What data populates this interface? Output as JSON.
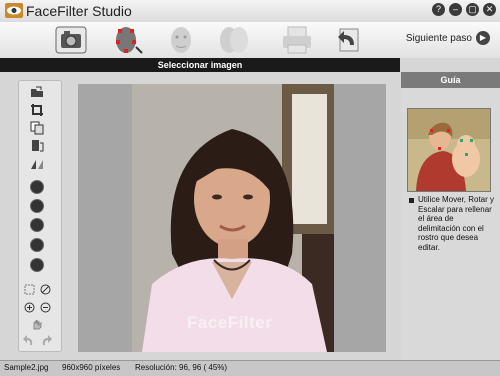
{
  "app": {
    "title": "FaceFilter Studio"
  },
  "window_buttons": [
    "?",
    "–",
    "▢",
    "✕"
  ],
  "toolbar": {
    "steps": [
      "open-photo",
      "face-detect",
      "face-adjust",
      "face-compare",
      "print",
      "back"
    ],
    "next_label": "Siguiente paso",
    "next_icon": "▶"
  },
  "header": {
    "title": "Seleccionar imagen"
  },
  "guide": {
    "title": "Guía",
    "text": "Utilice Mover, Rotar y Escalar para rellenar el área de delimitación con el rostro que desea editar."
  },
  "canvas": {
    "watermark": "FaceFilter"
  },
  "status": {
    "file": "Sample2.jpg",
    "size": "960x960 píxeles",
    "resolution": "Resolución: 96, 96 ( 45%)"
  },
  "colors": {
    "header_bg": "#1a1a1a",
    "guide_head_bg": "#7a7a7a",
    "canvas_bg": "#a6a6a6"
  }
}
